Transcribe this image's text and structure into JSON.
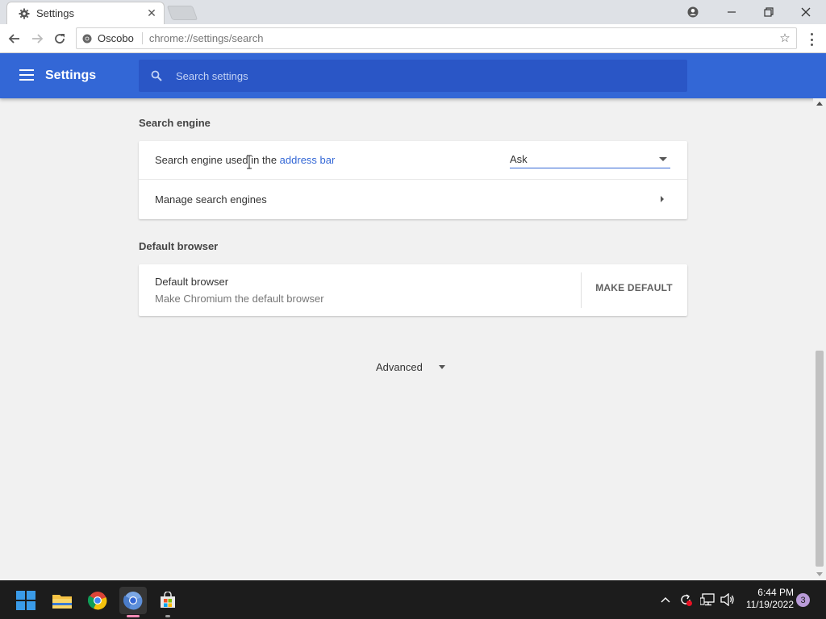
{
  "browser": {
    "tab_title": "Settings",
    "site_name": "Oscobo",
    "url_prefix": "chrome://",
    "url_strong": "settings",
    "url_suffix": "/search"
  },
  "settings": {
    "title": "Settings",
    "search_placeholder": "Search settings"
  },
  "search_engine": {
    "section_title": "Search engine",
    "used_label_prefix": "Search engine used in the ",
    "used_label_link": "address bar",
    "selected_engine": "Ask",
    "manage_label": "Manage search engines"
  },
  "default_browser": {
    "section_title": "Default browser",
    "title": "Default browser",
    "subtitle": "Make Chromium the default browser",
    "make_default_button": "MAKE DEFAULT"
  },
  "advanced_label": "Advanced",
  "taskbar": {
    "time": "6:44 PM",
    "date": "11/19/2022",
    "notification_count": "3"
  },
  "colors": {
    "header_blue": "#3367d6",
    "search_box_blue": "#2a56c6",
    "link_blue": "#3367d6",
    "taskbar": "#1c1c1c"
  },
  "icons": [
    "gear-icon",
    "close-icon",
    "account-icon",
    "minimize-icon",
    "restore-icon",
    "close-window-icon",
    "back-icon",
    "forward-icon",
    "reload-icon",
    "site-info-icon",
    "star-icon",
    "menu-dots-icon",
    "hamburger-icon",
    "search-icon",
    "dropdown-caret-icon",
    "chevron-right-icon",
    "windows-start-icon",
    "file-explorer-icon",
    "chrome-icon",
    "chromium-icon",
    "store-icon",
    "tray-chevron-icon",
    "sync-icon",
    "network-icon",
    "volume-icon"
  ]
}
